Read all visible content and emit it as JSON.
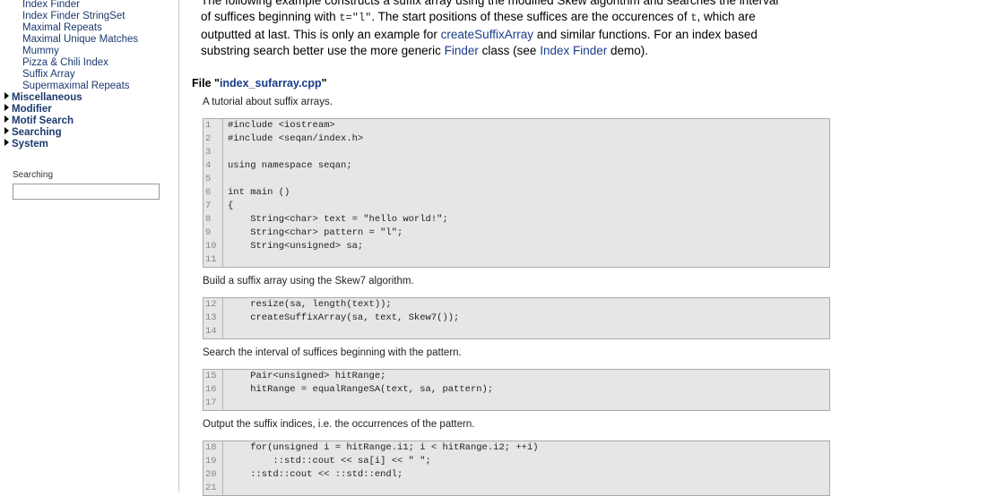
{
  "sidebar": {
    "sub_items": [
      "Index Finder",
      "Index Finder StringSet",
      "Maximal Repeats",
      "Maximal Unique Matches",
      "Mummy",
      "Pizza & Chili Index",
      "Suffix Array",
      "Supermaximal Repeats"
    ],
    "categories": [
      "Miscellaneous",
      "Modifier",
      "Motif Search",
      "Searching",
      "System"
    ],
    "search": {
      "label": "Searching",
      "value": "",
      "placeholder": ""
    }
  },
  "content": {
    "intro": {
      "line1_a": "The following example constructs a suffix array using the modified Skew algorithm and searches the interval",
      "line2_a": "of suffices beginning with ",
      "line2_code": "t=\"l\"",
      "line2_b": ". The start positions of these suffices are the occurences of ",
      "line2_code2": "t",
      "line2_c": ", which are",
      "line3_a": "outputted at last. This is only an example for ",
      "link_create": "createSuffixArray",
      "line3_b": " and similar functions. For an index based",
      "line4_a": "substring search better use the more generic ",
      "link_finder": "Finder",
      "line4_b": " class (see ",
      "link_index_finder": "Index Finder",
      "line4_c": " demo)."
    },
    "file_heading": {
      "prefix": "File \"",
      "filename": "index_sufarray.cpp",
      "suffix": "\""
    },
    "sections": [
      {
        "description": "A tutorial about suffix arrays.",
        "lines": [
          {
            "n": "1",
            "code": "#include <iostream>"
          },
          {
            "n": "2",
            "code": "#include <seqan/index.h>"
          },
          {
            "n": "3",
            "code": ""
          },
          {
            "n": "4",
            "code": "using namespace seqan;"
          },
          {
            "n": "5",
            "code": ""
          },
          {
            "n": "6",
            "code": "int main ()"
          },
          {
            "n": "7",
            "code": "{"
          },
          {
            "n": "8",
            "code": "    String<char> text = \"hello world!\";"
          },
          {
            "n": "9",
            "code": "    String<char> pattern = \"l\";"
          },
          {
            "n": "10",
            "code": "    String<unsigned> sa;"
          },
          {
            "n": "11",
            "code": ""
          }
        ]
      },
      {
        "description": "Build a suffix array using the Skew7 algorithm.",
        "lines": [
          {
            "n": "12",
            "code": "    resize(sa, length(text));"
          },
          {
            "n": "13",
            "code": "    createSuffixArray(sa, text, Skew7());"
          },
          {
            "n": "14",
            "code": ""
          }
        ]
      },
      {
        "description": "Search the interval of suffices beginning with the pattern.",
        "lines": [
          {
            "n": "15",
            "code": "    Pair<unsigned> hitRange;"
          },
          {
            "n": "16",
            "code": "    hitRange = equalRangeSA(text, sa, pattern);"
          },
          {
            "n": "17",
            "code": ""
          }
        ]
      },
      {
        "description": "Output the suffix indices, i.e. the occurrences of the pattern.",
        "lines": [
          {
            "n": "18",
            "code": "    for(unsigned i = hitRange.i1; i < hitRange.i2; ++i)"
          },
          {
            "n": "19",
            "code": "        ::std::cout << sa[i] << \" \";"
          },
          {
            "n": "20",
            "code": "    ::std::cout << ::std::endl;"
          },
          {
            "n": "21",
            "code": ""
          }
        ]
      }
    ]
  }
}
